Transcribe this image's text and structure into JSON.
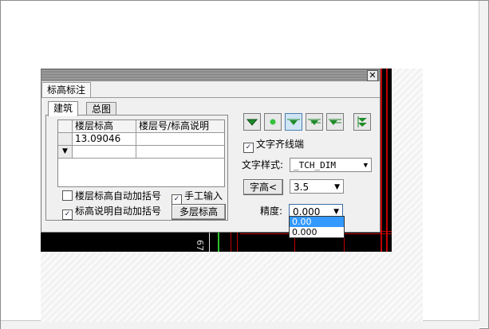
{
  "dialog": {
    "title": "标高标注",
    "close": "✕",
    "tabs": [
      {
        "label": "建筑"
      },
      {
        "label": "总图"
      }
    ],
    "table": {
      "headers": [
        "楼层标高",
        "楼层号/标高说明"
      ],
      "rows": [
        {
          "marker": "",
          "elevation": "13.09046",
          "note": ""
        },
        {
          "marker": "▼",
          "elevation": "",
          "note": ""
        }
      ]
    },
    "checkboxes": {
      "auto_bracket_floor": {
        "label": "楼层标高自动加括号",
        "checked": false,
        "mark": ""
      },
      "auto_bracket_note": {
        "label": "标高说明自动加括号",
        "checked": true,
        "mark": "✓"
      },
      "manual_input": {
        "label": "手工输入",
        "checked": true,
        "mark": "✓"
      },
      "align_text": {
        "label": "文字齐线端",
        "checked": true,
        "mark": "✓"
      }
    },
    "buttons": {
      "multi_level": "多层标高",
      "text_height": "字高<"
    },
    "icons": [
      "elevation-filled-triangle-icon",
      "elevation-dot-icon",
      "elevation-line-triangle-icon",
      "elevation-line-half-icon",
      "elevation-line-left-icon",
      "elevation-double-icon"
    ],
    "text_style": {
      "label": "文字样式:",
      "value": "_TCH_DIM"
    },
    "text_height_value": "3.5",
    "precision": {
      "label": "精度:",
      "value": "0.000",
      "options": [
        "0.00",
        "0.000"
      ]
    },
    "arrow": "▼"
  },
  "canvas": {
    "dimension_text": "67"
  },
  "colors": {
    "accent": "#2e9e3a",
    "cad_red": "#cc0000",
    "highlight": "#3399ff"
  }
}
